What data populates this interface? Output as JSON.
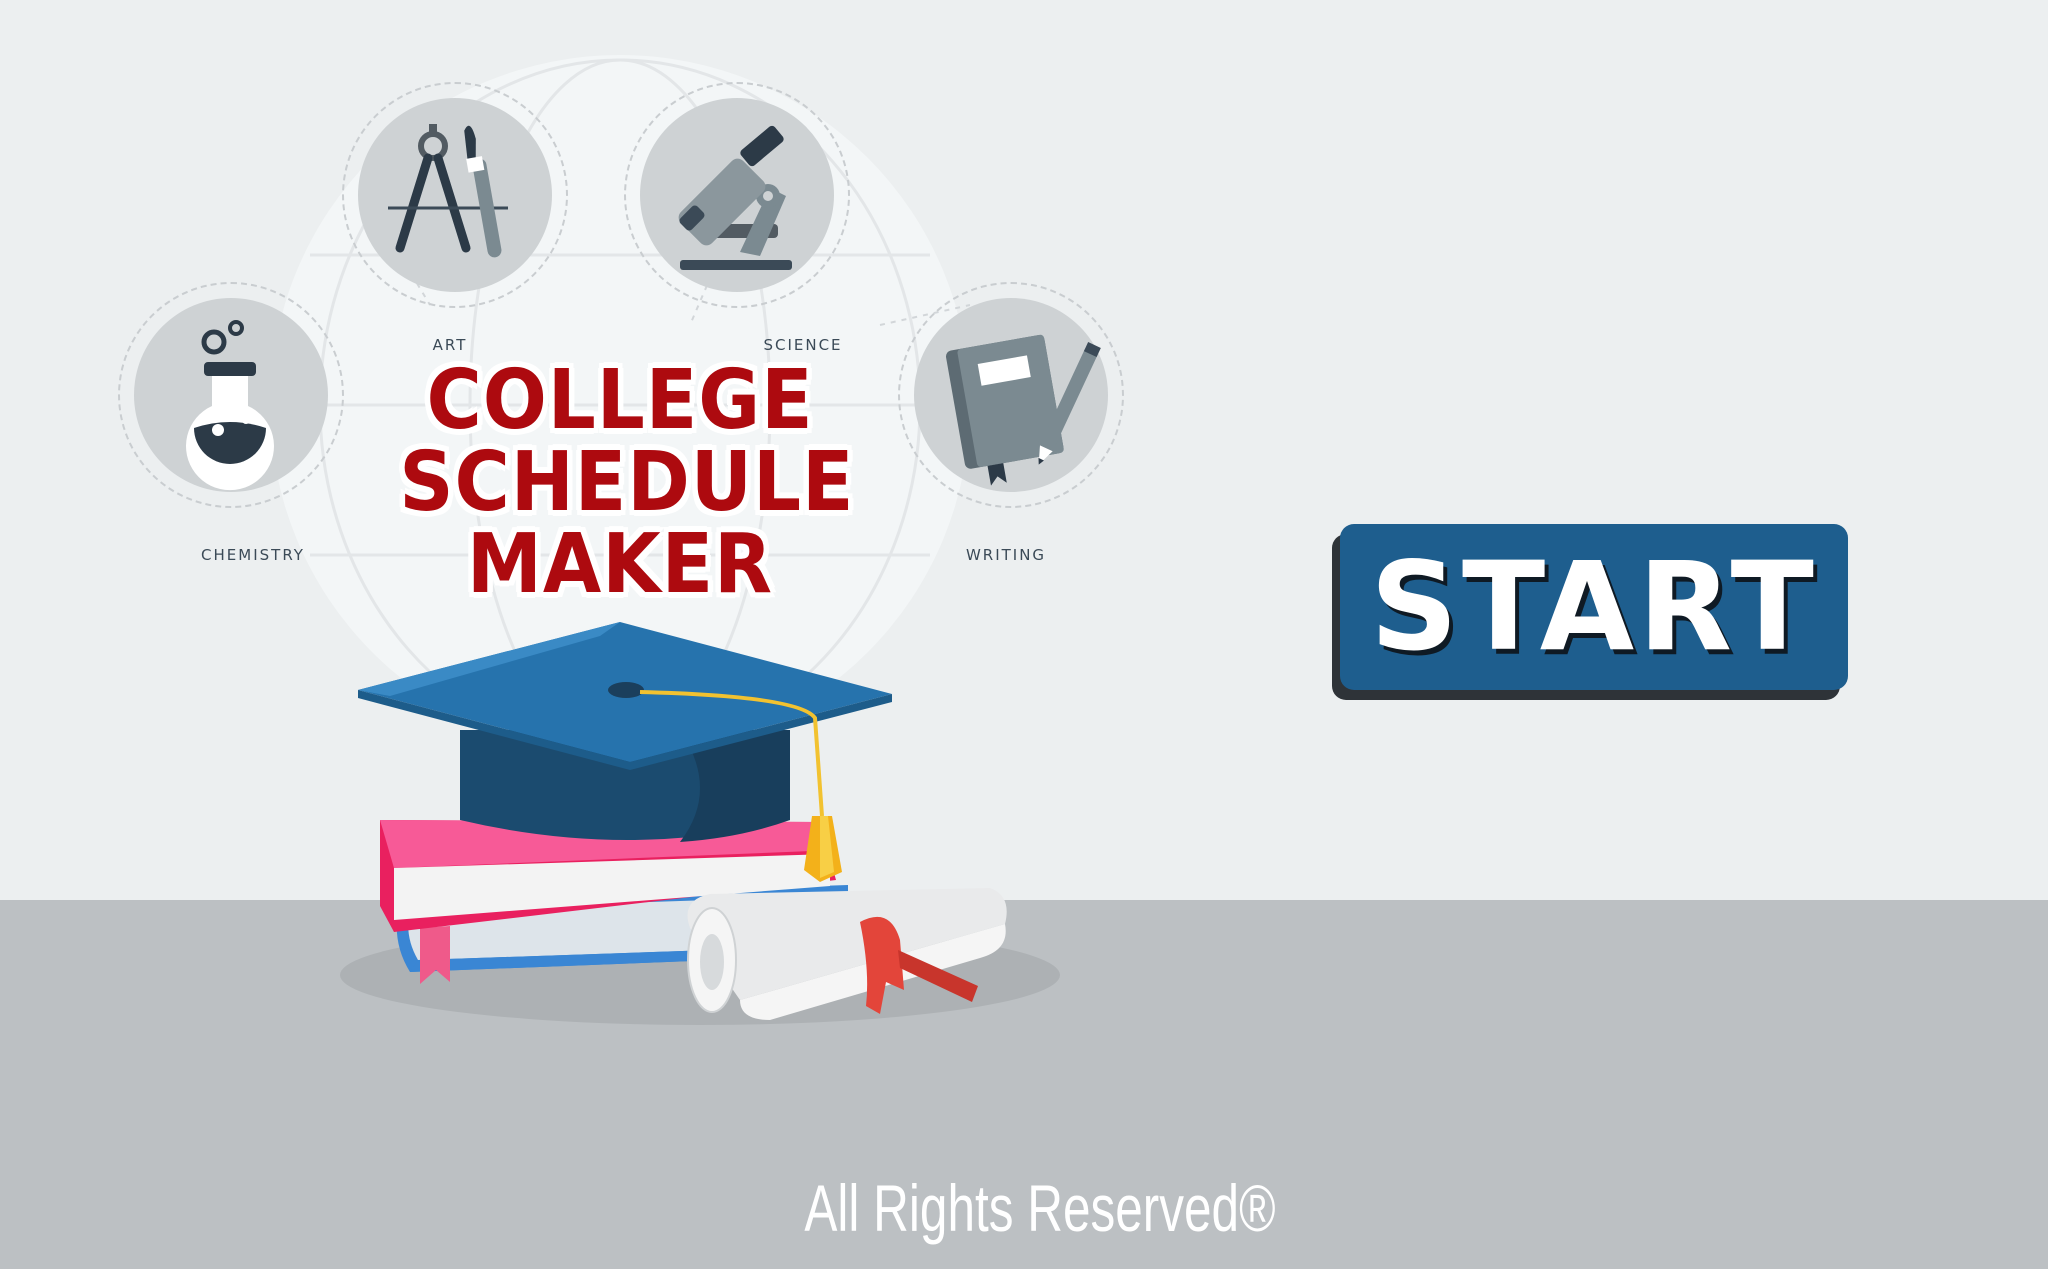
{
  "title": {
    "line1": "COLLEGE",
    "line2": "SCHEDULE",
    "line3": "MAKER"
  },
  "subjects": [
    {
      "label": "CHEMISTRY",
      "icon": "flask-icon"
    },
    {
      "label": "ART",
      "icon": "compass-brush-icon"
    },
    {
      "label": "SCIENCE",
      "icon": "microscope-icon"
    },
    {
      "label": "WRITING",
      "icon": "notebook-pen-icon"
    }
  ],
  "start_button": {
    "label": "START"
  },
  "footer": {
    "text": "All Rights Reserved®"
  },
  "colors": {
    "background": "#eceff0",
    "floor": "#bcc0c3",
    "title": "#ad0a0f",
    "button": "#1e5e8e",
    "button_shadow": "#2e3338"
  }
}
